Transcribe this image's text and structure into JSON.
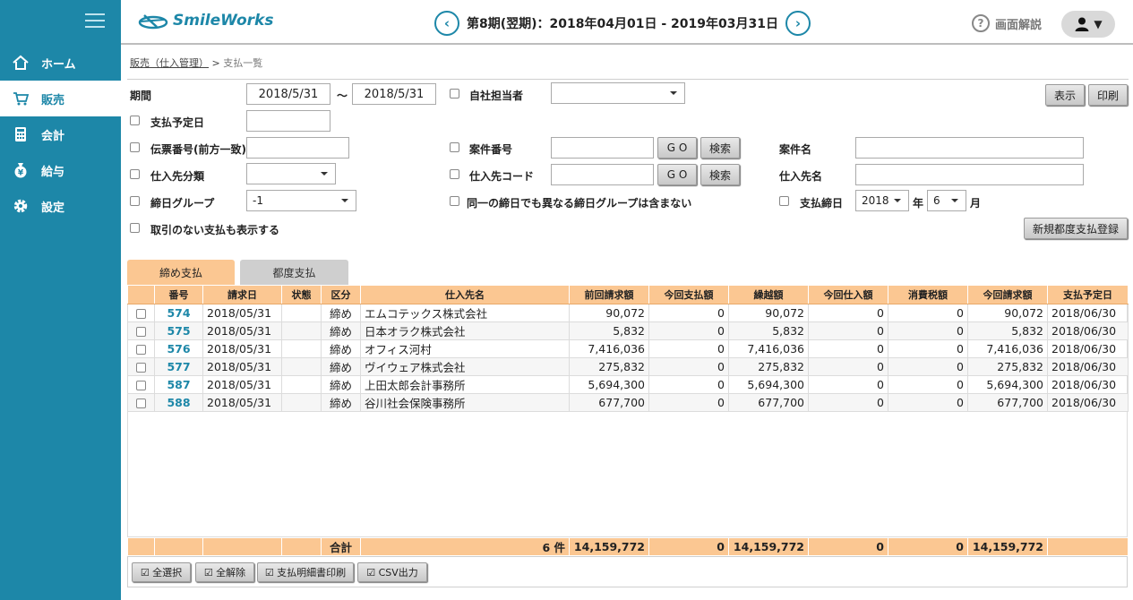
{
  "brand": {
    "name": "SmileWorks",
    "color": "#1d87a8"
  },
  "header": {
    "period": "第8期(翌期)：2018年04月01日 - 2019年03月31日",
    "prev": "‹",
    "next": "›",
    "help": "画面解説",
    "user_caret": "▼"
  },
  "sidebar": {
    "items": [
      {
        "label": "ホーム",
        "icon": "home-icon"
      },
      {
        "label": "販売",
        "icon": "cart-icon"
      },
      {
        "label": "会計",
        "icon": "calculator-icon"
      },
      {
        "label": "給与",
        "icon": "money-bag-icon"
      },
      {
        "label": "設定",
        "icon": "gear-icon"
      }
    ]
  },
  "breadcrumb": {
    "parent": "販売（仕入管理）",
    "sep": ">",
    "current": "支払一覧"
  },
  "form": {
    "period_label": "期間",
    "period_from": "2018/5/31",
    "period_tilde": "〜",
    "period_to": "2018/5/31",
    "staff_label": "自社担当者",
    "staff_value": "",
    "pay_date_label": "支払予定日",
    "slip_label": "伝票番号(前方一致)",
    "case_no_label": "案件番号",
    "case_name_label": "案件名",
    "supplier_class_label": "仕入先分類",
    "supplier_code_label": "仕入先コード",
    "supplier_name_label": "仕入先名",
    "closing_group_label": "締日グループ",
    "closing_group_value": "-1",
    "exclude_label": "同一の締日でも異なる締日グループは含まない",
    "pay_close_label": "支払締日",
    "year_value": "2018",
    "year_unit": "年",
    "month_value": "6",
    "month_unit": "月",
    "show_no_trade_label": "取引のない支払も表示する",
    "go": "G O",
    "search": "検索",
    "show_btn": "表示",
    "print_btn": "印刷",
    "new_btn": "新規都度支払登録"
  },
  "tabs": [
    {
      "label": "締め支払"
    },
    {
      "label": "都度支払"
    }
  ],
  "table": {
    "headers": [
      "",
      "番号",
      "請求日",
      "状態",
      "区分",
      "仕入先名",
      "前回請求額",
      "今回支払額",
      "繰越額",
      "今回仕入額",
      "消費税額",
      "今回請求額",
      "支払予定日"
    ],
    "rows": [
      {
        "no": "574",
        "date": "2018/05/31",
        "status": "",
        "kind": "締め",
        "supplier": "エムコテックス株式会社",
        "prev": "90,072",
        "paid": "0",
        "carry": "90,072",
        "purchase": "0",
        "tax": "0",
        "bill": "90,072",
        "due": "2018/06/30"
      },
      {
        "no": "575",
        "date": "2018/05/31",
        "status": "",
        "kind": "締め",
        "supplier": "日本オラク株式会社",
        "prev": "5,832",
        "paid": "0",
        "carry": "5,832",
        "purchase": "0",
        "tax": "0",
        "bill": "5,832",
        "due": "2018/06/30"
      },
      {
        "no": "576",
        "date": "2018/05/31",
        "status": "",
        "kind": "締め",
        "supplier": "オフィス河村",
        "prev": "7,416,036",
        "paid": "0",
        "carry": "7,416,036",
        "purchase": "0",
        "tax": "0",
        "bill": "7,416,036",
        "due": "2018/06/30"
      },
      {
        "no": "577",
        "date": "2018/05/31",
        "status": "",
        "kind": "締め",
        "supplier": "ヴイウェア株式会社",
        "prev": "275,832",
        "paid": "0",
        "carry": "275,832",
        "purchase": "0",
        "tax": "0",
        "bill": "275,832",
        "due": "2018/06/30"
      },
      {
        "no": "587",
        "date": "2018/05/31",
        "status": "",
        "kind": "締め",
        "supplier": "上田太郎会計事務所",
        "prev": "5,694,300",
        "paid": "0",
        "carry": "5,694,300",
        "purchase": "0",
        "tax": "0",
        "bill": "5,694,300",
        "due": "2018/06/30"
      },
      {
        "no": "588",
        "date": "2018/05/31",
        "status": "",
        "kind": "締め",
        "supplier": "谷川社会保険事務所",
        "prev": "677,700",
        "paid": "0",
        "carry": "677,700",
        "purchase": "0",
        "tax": "0",
        "bill": "677,700",
        "due": "2018/06/30"
      }
    ],
    "totals": {
      "label": "合計",
      "count": "6 件",
      "prev": "14,159,772",
      "paid": "0",
      "carry": "14,159,772",
      "purchase": "0",
      "tax": "0",
      "bill": "14,159,772"
    }
  },
  "actions": [
    {
      "label": "☑ 全選択"
    },
    {
      "label": "☑ 全解除"
    },
    {
      "label": "☑ 支払明細書印刷"
    },
    {
      "label": "☑ CSV出力"
    }
  ]
}
